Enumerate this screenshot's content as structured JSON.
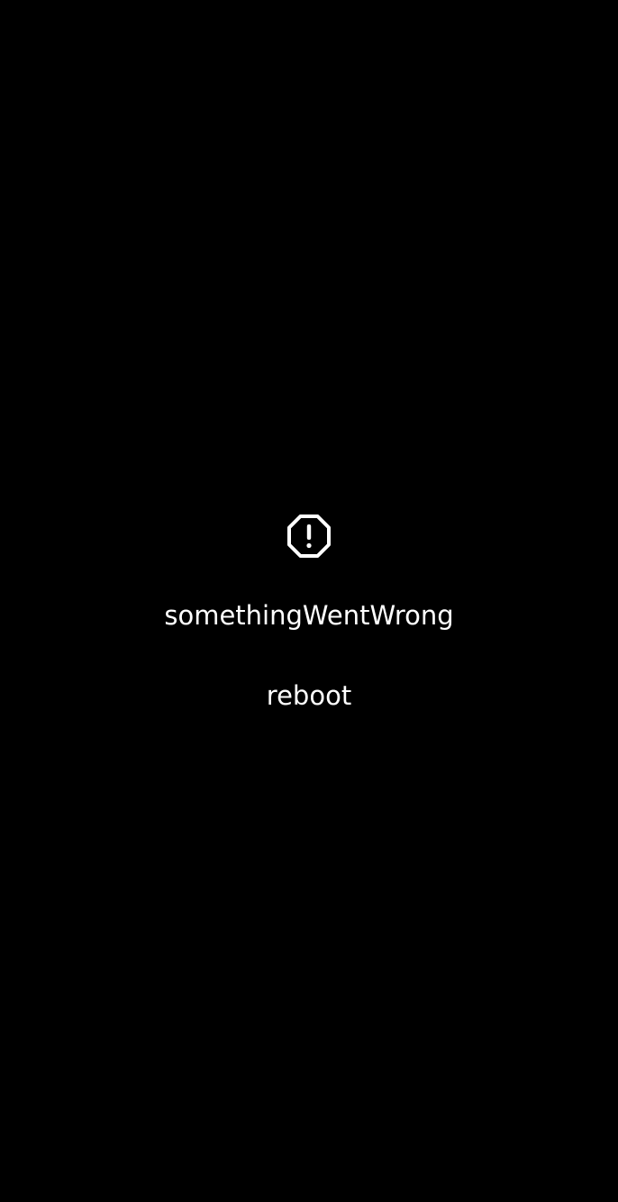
{
  "error_screen": {
    "icon": "alert-octagon-icon",
    "message": "somethingWentWrong",
    "reboot_label": "reboot"
  },
  "colors": {
    "background": "#000000",
    "foreground": "#ffffff"
  }
}
